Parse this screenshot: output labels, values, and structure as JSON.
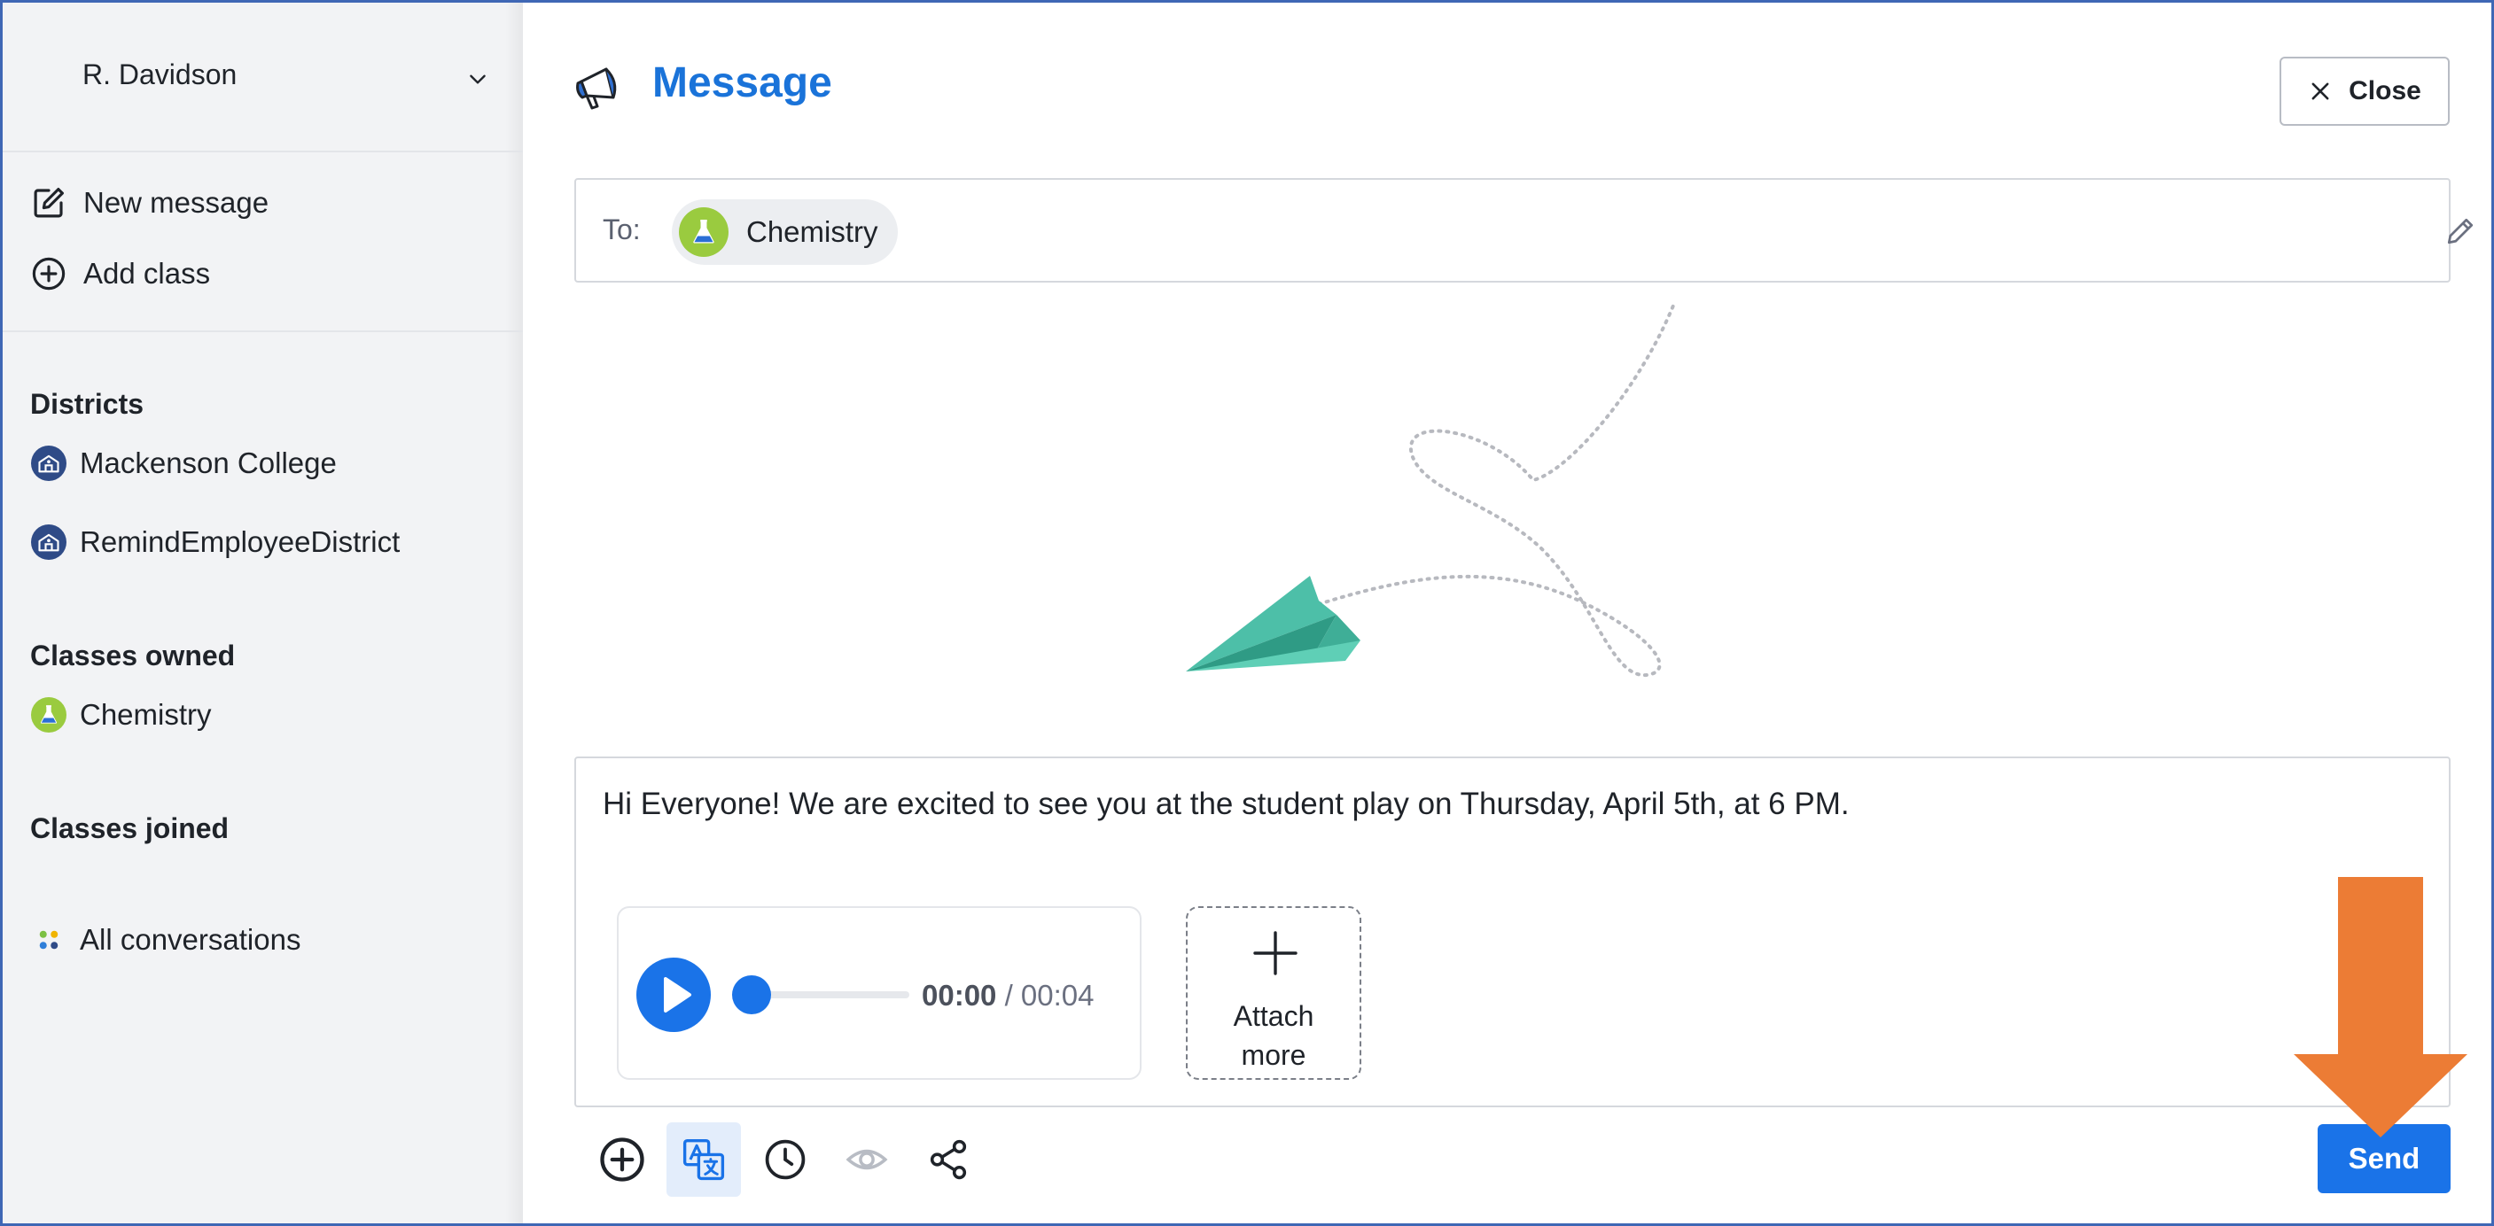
{
  "colors": {
    "accent": "#1a73e8",
    "title": "#1a73d9",
    "sidebar_bg": "#f2f3f5",
    "plane": "#4dbfa8",
    "callout_arrow": "#ec7c35",
    "class_badge": "#9acb3f",
    "district_badge": "#2f4b87"
  },
  "sidebar": {
    "account_name": "R. Davidson",
    "actions": [
      {
        "label": "New message",
        "icon": "edit-square-icon"
      },
      {
        "label": "Add class",
        "icon": "plus-circle-icon"
      }
    ],
    "districts_heading": "Districts",
    "districts": [
      {
        "label": "Mackenson College",
        "icon": "school-icon"
      },
      {
        "label": "RemindEmployeeDistrict",
        "icon": "school-icon"
      }
    ],
    "classes_owned_heading": "Classes owned",
    "classes_owned": [
      {
        "label": "Chemistry",
        "icon": "flask-icon"
      }
    ],
    "classes_joined_heading": "Classes joined",
    "all_conversations_label": "All conversations"
  },
  "header": {
    "title": "Message",
    "title_icon": "megaphone-icon",
    "close_label": "Close"
  },
  "recipients": {
    "to_label": "To:",
    "chips": [
      {
        "label": "Chemistry",
        "icon": "flask-icon"
      }
    ]
  },
  "compose": {
    "message": "Hi Everyone! We are excited to see you at the student play on Thursday, April 5th, at 6 PM.",
    "audio": {
      "current": "00:00",
      "separator": " / ",
      "total": "00:04",
      "progress": 0
    },
    "attach_line1": "Attach",
    "attach_line2": "more"
  },
  "toolbar": {
    "tools": [
      "plus-circle-icon",
      "translate-icon",
      "clock-icon",
      "eye-icon",
      "share-icon"
    ],
    "send_label": "Send"
  }
}
